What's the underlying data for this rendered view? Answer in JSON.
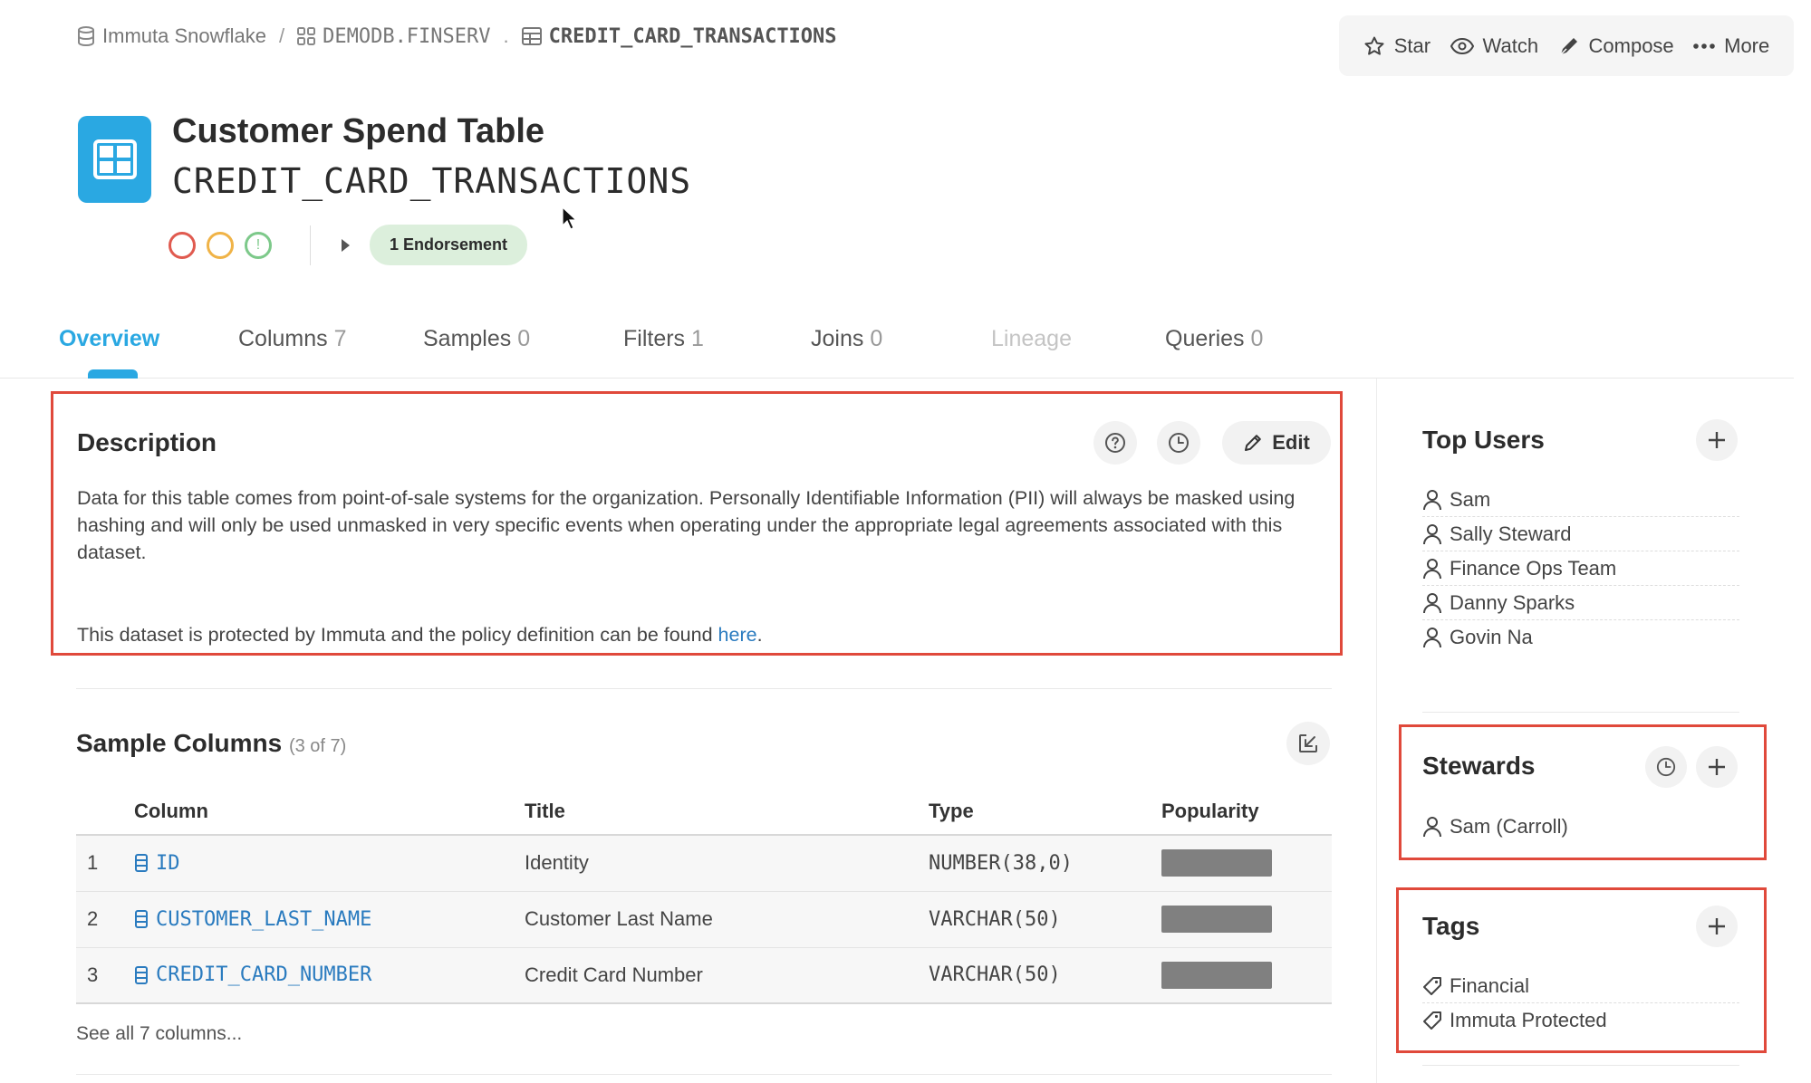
{
  "breadcrumb": {
    "source": "Immuta Snowflake",
    "sep1": "/",
    "schema": "DEMODB.FINSERV",
    "sep2": ".",
    "table": "CREDIT_CARD_TRANSACTIONS"
  },
  "actions": {
    "star": "Star",
    "watch": "Watch",
    "compose": "Compose",
    "more": "More"
  },
  "header": {
    "title": "Customer Spend Table",
    "subtitle": "CREDIT_CARD_TRANSACTIONS",
    "status_green": "!",
    "endorsement": "1 Endorsement"
  },
  "tabs": [
    {
      "label": "Overview",
      "count": ""
    },
    {
      "label": "Columns",
      "count": "7"
    },
    {
      "label": "Samples",
      "count": "0"
    },
    {
      "label": "Filters",
      "count": "1"
    },
    {
      "label": "Joins",
      "count": "0"
    },
    {
      "label": "Lineage",
      "count": ""
    },
    {
      "label": "Queries",
      "count": "0"
    }
  ],
  "description": {
    "title": "Description",
    "edit_label": "Edit",
    "body": "Data for this table comes from point-of-sale systems for the organization. Personally Identifiable Information (PII) will always be masked using hashing and will only be used unmasked in very specific events when operating under the appropriate legal agreements associated with this dataset.",
    "footer_prefix": "This dataset is protected by Immuta and the policy definition can be found ",
    "footer_link": "here",
    "footer_suffix": "."
  },
  "sample_columns": {
    "title": "Sample Columns",
    "subtitle": "(3 of 7)",
    "headers": [
      "Column",
      "Title",
      "Type",
      "Popularity"
    ],
    "rows": [
      {
        "index": "1",
        "column": "ID",
        "title": "Identity",
        "type": "NUMBER(38,0)",
        "popularity": 1.0
      },
      {
        "index": "2",
        "column": "CUSTOMER_LAST_NAME",
        "title": "Customer Last Name",
        "type": "VARCHAR(50)",
        "popularity": 1.0
      },
      {
        "index": "3",
        "column": "CREDIT_CARD_NUMBER",
        "title": "Credit Card Number",
        "type": "VARCHAR(50)",
        "popularity": 1.0
      }
    ],
    "see_all": "See all 7 columns..."
  },
  "top_users": {
    "title": "Top Users",
    "users": [
      "Sam",
      "Sally Steward",
      "Finance Ops Team",
      "Danny Sparks",
      "Govin Na"
    ]
  },
  "stewards": {
    "title": "Stewards",
    "users": [
      "Sam (Carroll)"
    ]
  },
  "tags": {
    "title": "Tags",
    "items": [
      "Financial",
      "Immuta Protected"
    ]
  },
  "colors": {
    "accent": "#2aa8e2",
    "highlight_border": "#e0493b",
    "link": "#2a7bbf",
    "endorsement_bg": "#dcefdc",
    "status_red": "#e05a4f",
    "status_yellow": "#f0b347",
    "status_green": "#7dc98a"
  }
}
